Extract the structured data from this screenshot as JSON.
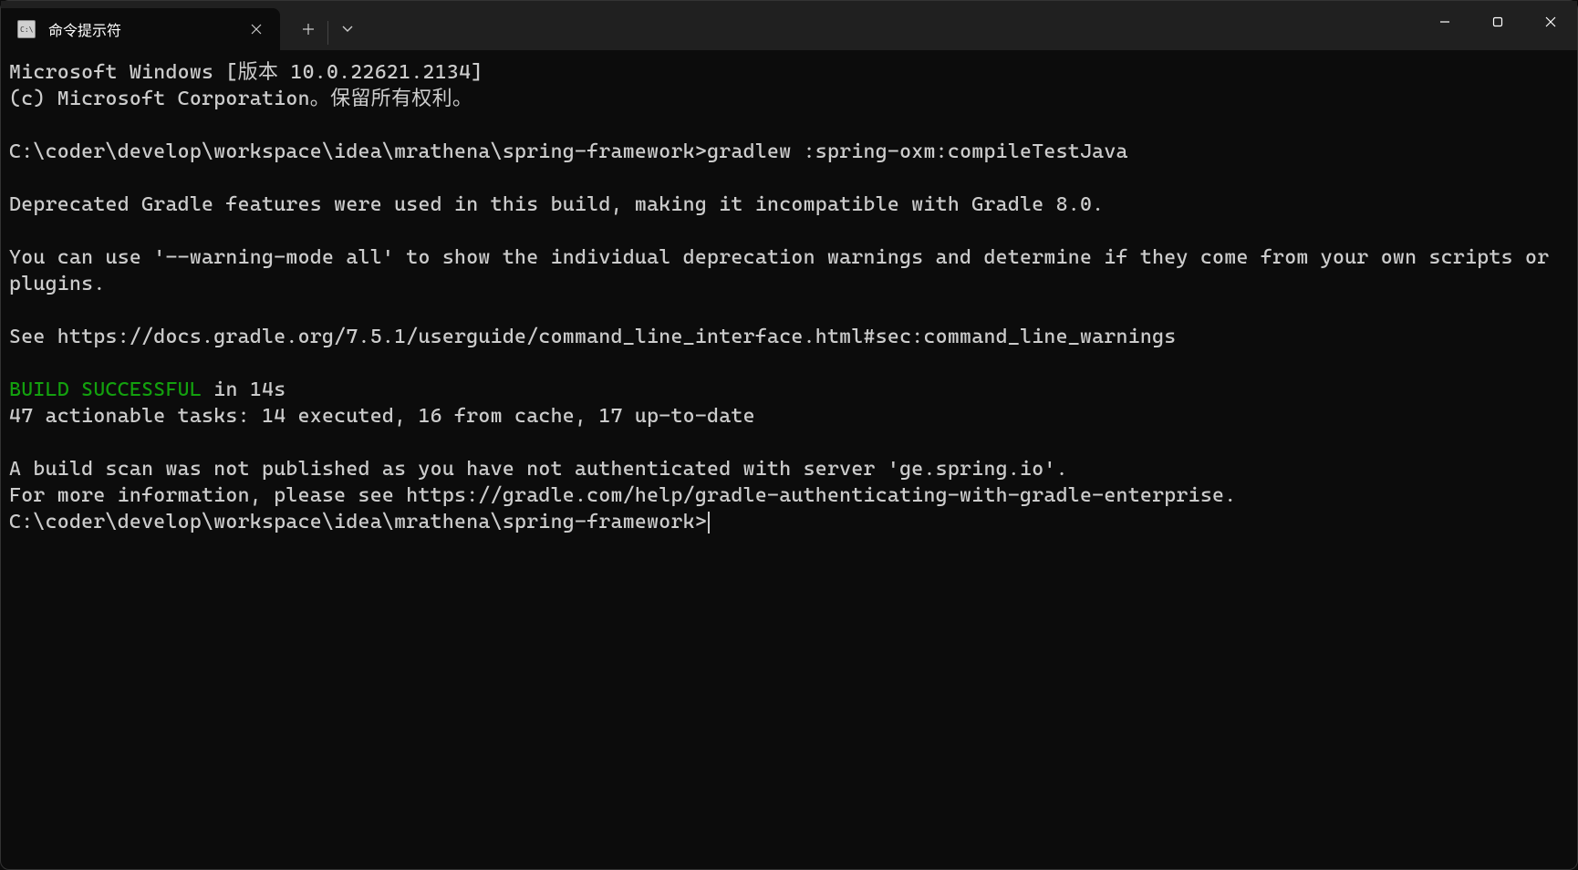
{
  "titlebar": {
    "tab_title": "命令提示符",
    "tab_icon_label": "cmd"
  },
  "terminal": {
    "line1": "Microsoft Windows [版本 10.0.22621.2134]",
    "line2": "(c) Microsoft Corporation。保留所有权利。",
    "blank": "",
    "prompt1_path": "C:\\coder\\develop\\workspace\\idea\\mrathena\\spring-framework>",
    "prompt1_cmd": "gradlew :spring-oxm:compileTestJava",
    "deprecated": "Deprecated Gradle features were used in this build, making it incompatible with Gradle 8.0.",
    "warning_mode": "You can use '--warning-mode all' to show the individual deprecation warnings and determine if they come from your own scripts or plugins.",
    "see_link": "See https://docs.gradle.org/7.5.1/userguide/command_line_interface.html#sec:command_line_warnings",
    "build_success": "BUILD SUCCESSFUL",
    "build_time": " in 14s",
    "tasks": "47 actionable tasks: 14 executed, 16 from cache, 17 up-to-date",
    "scan": "A build scan was not published as you have not authenticated with server 'ge.spring.io'.",
    "more_info": "For more information, please see https://gradle.com/help/gradle-authenticating-with-gradle-enterprise.",
    "prompt2": "C:\\coder\\develop\\workspace\\idea\\mrathena\\spring-framework>"
  }
}
